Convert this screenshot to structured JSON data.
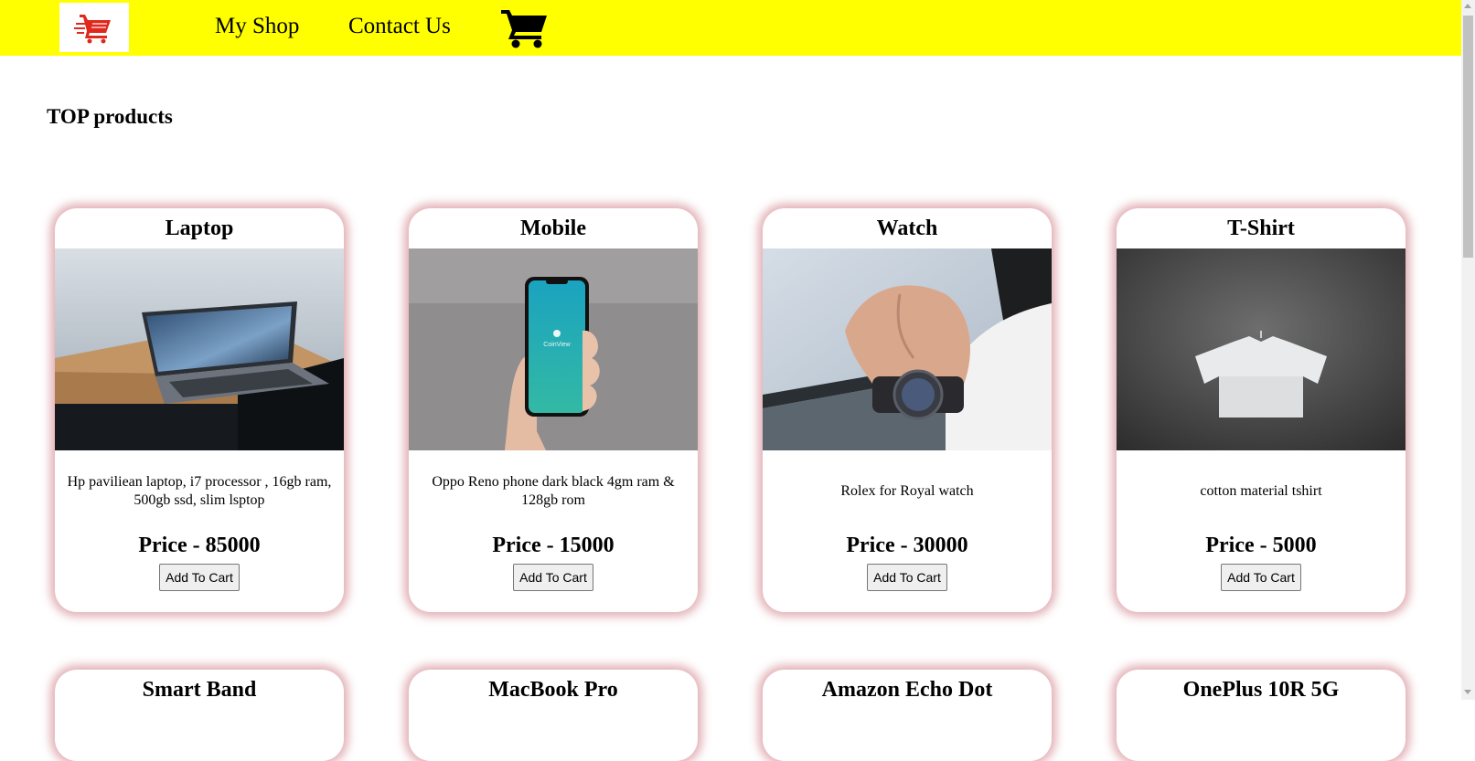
{
  "nav": {
    "logo_icon": "shopping-cart-logo-icon",
    "links": [
      "My Shop",
      "Contact Us"
    ],
    "cart_icon": "cart-icon"
  },
  "page": {
    "section_title": "TOP products"
  },
  "colors": {
    "navbar": "#ffff00",
    "card_shadow": "#be505a",
    "logo_red": "#e0281c"
  },
  "products": [
    {
      "name": "Laptop",
      "image": "laptop-photo",
      "description": "Hp paviliean laptop, i7 processor , 16gb ram, 500gb ssd, slim lsptop",
      "price": "Price - 85000",
      "button": "Add To Cart"
    },
    {
      "name": "Mobile",
      "image": "mobile-photo",
      "description": "Oppo Reno phone dark black 4gm ram & 128gb rom",
      "price": "Price - 15000",
      "button": "Add To Cart"
    },
    {
      "name": "Watch",
      "image": "watch-photo",
      "description": "Rolex for Royal watch",
      "price": "Price - 30000",
      "button": "Add To Cart"
    },
    {
      "name": "T-Shirt",
      "image": "tshirt-photo",
      "description": "cotton material tshirt",
      "price": "Price - 5000",
      "button": "Add To Cart"
    },
    {
      "name": "Smart Band"
    },
    {
      "name": "MacBook Pro"
    },
    {
      "name": "Amazon Echo Dot"
    },
    {
      "name": "OnePlus 10R 5G"
    }
  ],
  "phone_screen_text": "CoinView"
}
